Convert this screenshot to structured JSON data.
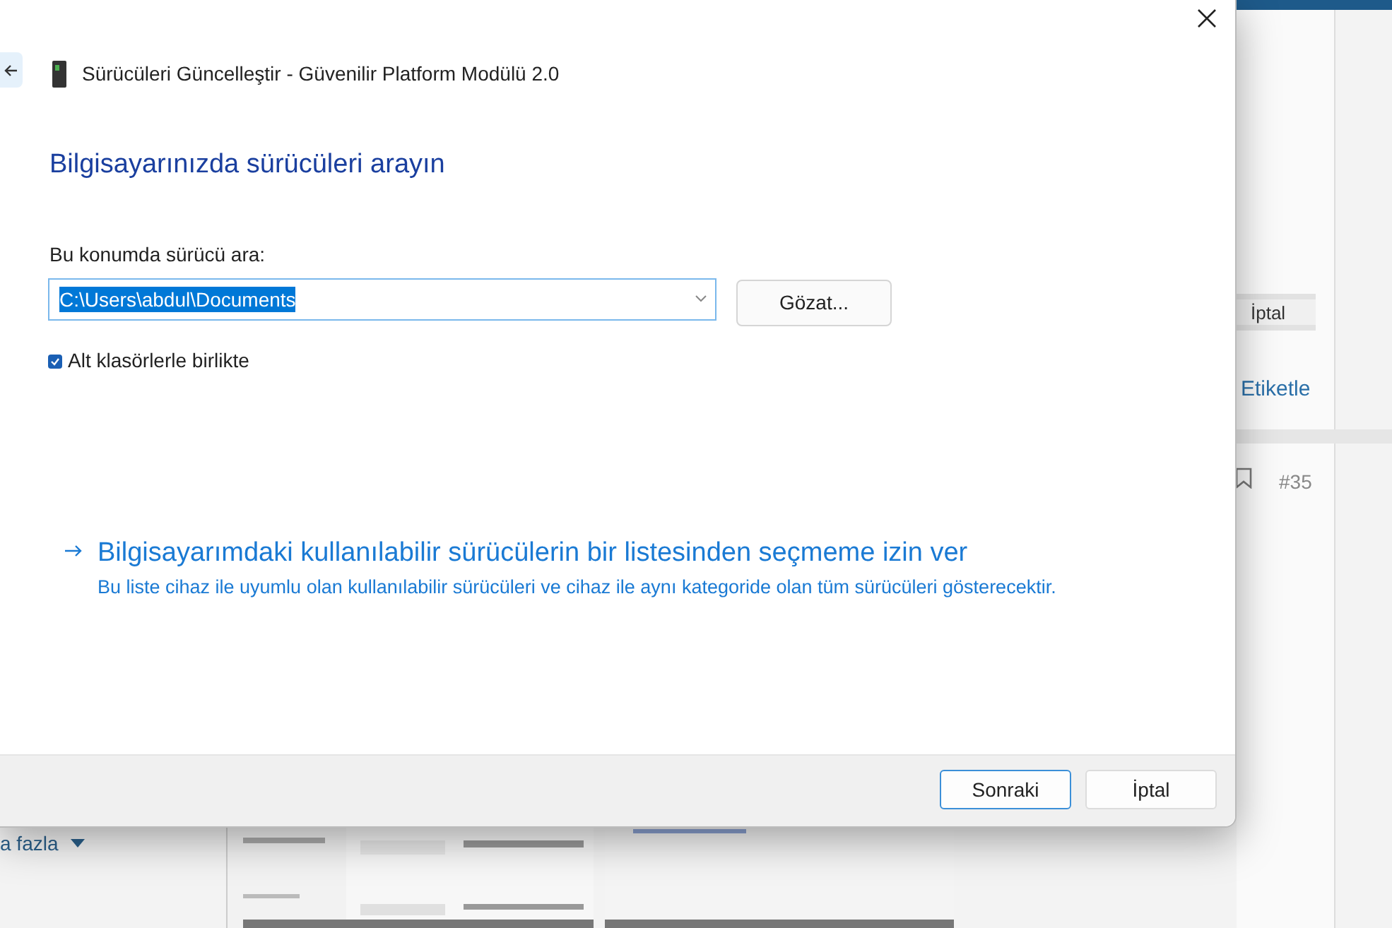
{
  "background_page": {
    "cancel_button": "İptal",
    "tag_link": "Etiketle",
    "post_number": "#35",
    "more_link": "a fazla"
  },
  "dialog": {
    "title": "Sürücüleri Güncelleştir - Güvenilir Platform Modülü 2.0",
    "heading": "Bilgisayarınızda sürücüleri arayın",
    "location_label": "Bu konumda sürücü ara:",
    "path_field": {
      "value": "C:\\Users\\abdul\\Documents",
      "text_selected": true
    },
    "browse_button": "Gözat...",
    "subfolders": {
      "label": "Alt klasörlerle birlikte",
      "checked": true
    },
    "pick_link": {
      "title": "Bilgisayarımdaki kullanılabilir sürücülerin bir listesinden seçmeme izin ver",
      "description": "Bu liste cihaz ile uyumlu olan kullanılabilir sürücüleri ve cihaz ile aynı kategoride olan tüm sürücüleri gösterecektir."
    },
    "buttons": [
      {
        "label": "Sonraki",
        "default": true
      },
      {
        "label": "İptal",
        "default": false
      }
    ]
  }
}
